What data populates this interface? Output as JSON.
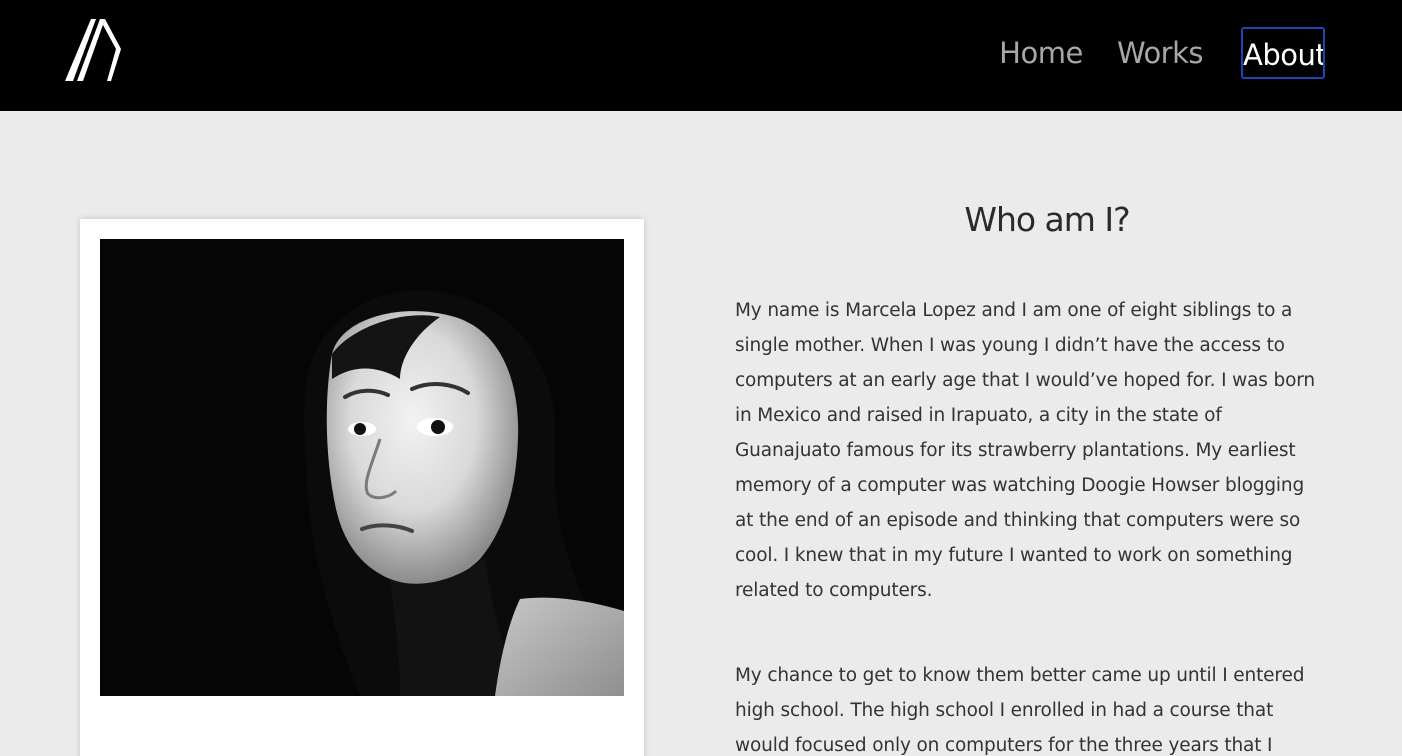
{
  "header": {
    "logo_alt": "M logo",
    "nav": {
      "home": "Home",
      "works": "Works",
      "about": "About"
    },
    "active_item": "About"
  },
  "about": {
    "title": "Who am I?",
    "paragraphs": [
      "My name is Marcela Lopez and I am one of eight siblings to a single mother. When I was young I didn’t have the access to computers at an early age that I would’ve hoped for. I was born in Mexico and raised in Irapuato, a city in the state of Guanajuato famous for its strawberry plantations. My earliest memory of a computer was watching Doogie Howser blogging at the end of an episode and thinking that computers were so cool. I knew that in my future I wanted to work on something related to computers.",
      "My chance to get to know them better came up until I entered high school. The high school I enrolled in had a course that would focused only on computers for the three years that I"
    ]
  },
  "colors": {
    "header_bg": "#000000",
    "page_bg": "#ebebeb",
    "nav_inactive": "#a7a7a7",
    "nav_active": "#ffffff",
    "focus_outline": "#1e44b8",
    "body_text": "#333333"
  },
  "icons": {
    "logo": "m-logo-icon"
  }
}
